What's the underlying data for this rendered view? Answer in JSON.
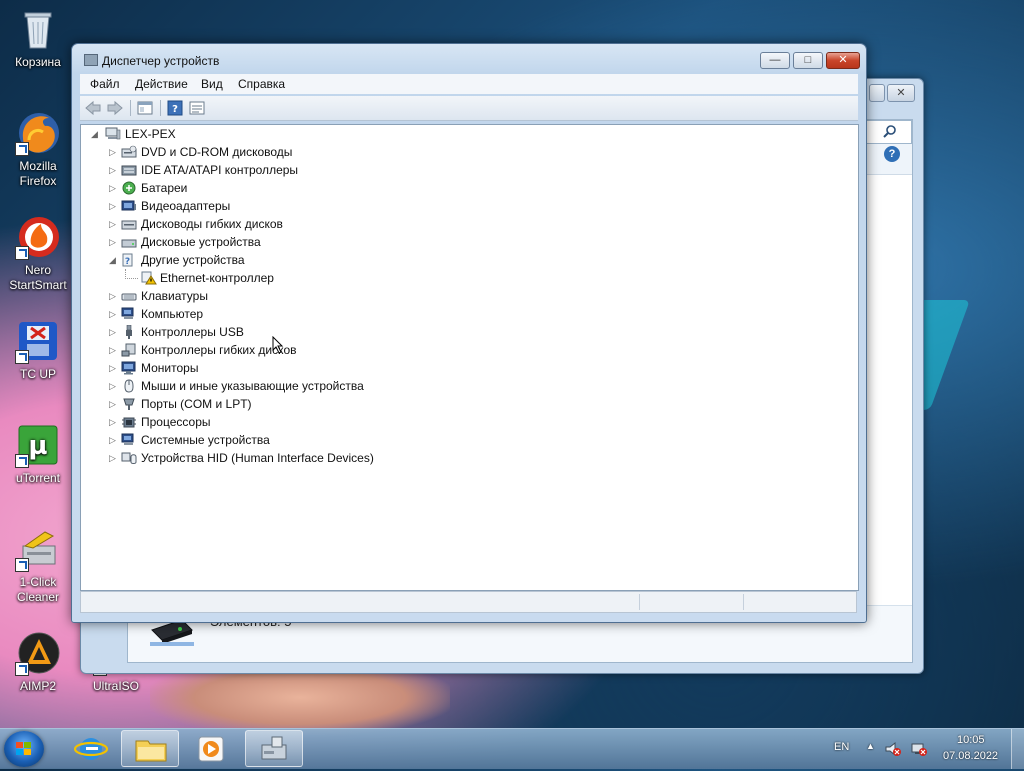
{
  "desktop": {
    "icons": [
      {
        "label": "Корзина"
      },
      {
        "label": "Mozilla Firefox"
      },
      {
        "label": "Nero StartSmart"
      },
      {
        "label": "TC UP"
      },
      {
        "label": "uTorrent"
      },
      {
        "label": "1-Click Cleaner"
      },
      {
        "label": "AIMP2"
      },
      {
        "label": "UltraISO"
      }
    ]
  },
  "back_window": {
    "items_count": "Элементов: 5"
  },
  "window": {
    "title": "Диспетчер устройств",
    "buttons": {
      "minimize": "—",
      "maximize": "□",
      "close": "✕"
    },
    "menu": [
      "Файл",
      "Действие",
      "Вид",
      "Справка"
    ],
    "tree": {
      "root": "LEX-PEX",
      "items": [
        {
          "label": "DVD и CD-ROM дисководы",
          "icon": "dvd-drive-icon",
          "expanded": false
        },
        {
          "label": "IDE ATA/ATAPI контроллеры",
          "icon": "ide-controller-icon",
          "expanded": false
        },
        {
          "label": "Батареи",
          "icon": "battery-icon",
          "expanded": false
        },
        {
          "label": "Видеоадаптеры",
          "icon": "display-adapter-icon",
          "expanded": false
        },
        {
          "label": "Дисководы гибких дисков",
          "icon": "floppy-drive-icon",
          "expanded": false
        },
        {
          "label": "Дисковые устройства",
          "icon": "disk-drive-icon",
          "expanded": false
        },
        {
          "label": "Другие устройства",
          "icon": "unknown-device-icon",
          "expanded": true
        },
        {
          "label": "Ethernet-контроллер",
          "icon": "warning-device-icon",
          "child": true
        },
        {
          "label": "Клавиатуры",
          "icon": "keyboard-icon",
          "expanded": false
        },
        {
          "label": "Компьютер",
          "icon": "computer-icon",
          "expanded": false
        },
        {
          "label": "Контроллеры USB",
          "icon": "usb-icon",
          "expanded": false
        },
        {
          "label": "Контроллеры гибких дисков",
          "icon": "floppy-controller-icon",
          "expanded": false
        },
        {
          "label": "Мониторы",
          "icon": "monitor-icon",
          "expanded": false
        },
        {
          "label": "Мыши и иные указывающие устройства",
          "icon": "mouse-icon",
          "expanded": false
        },
        {
          "label": "Порты (COM и LPT)",
          "icon": "port-icon",
          "expanded": false
        },
        {
          "label": "Процессоры",
          "icon": "processor-icon",
          "expanded": false
        },
        {
          "label": "Системные устройства",
          "icon": "system-device-icon",
          "expanded": false
        },
        {
          "label": "Устройства HID (Human Interface Devices)",
          "icon": "hid-icon",
          "expanded": false
        }
      ]
    }
  },
  "taskbar": {
    "language": "EN",
    "time": "10:05",
    "date": "07.08.2022"
  },
  "colors": {
    "accent": "#1a5fb4",
    "warning": "#f2c200"
  }
}
